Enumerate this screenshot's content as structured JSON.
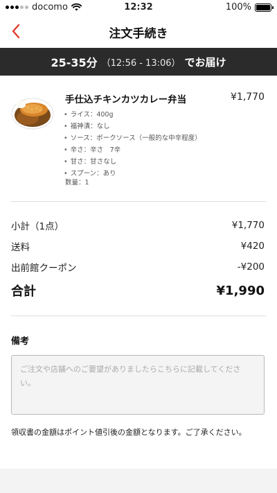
{
  "status_bar": {
    "carrier": "docomo",
    "time": "12:32",
    "battery": "100%"
  },
  "nav": {
    "title": "注文手続き",
    "back_icon": "chevron-left-icon",
    "accent": "#e23b2e"
  },
  "delivery": {
    "range": "25-35分",
    "window": "（12:56 - 13:06）",
    "suffix": "でお届け"
  },
  "item": {
    "name": "手仕込チキンカツカレー弁当",
    "price": "¥1,770",
    "options": [
      "ライス：400g",
      "福神漬：なし",
      "ソース：ポークソース（一般的な中辛程度）",
      "辛さ：辛さ　7辛",
      "甘さ：甘さなし",
      "スプーン：あり"
    ],
    "quantity": "数量：1"
  },
  "summary": {
    "subtotal_label": "小計（1点）",
    "subtotal_value": "¥1,770",
    "shipping_label": "送料",
    "shipping_value": "¥420",
    "coupon_label": "出前館クーポン",
    "coupon_value": "-¥200",
    "total_label": "合計",
    "total_value": "¥1,990"
  },
  "remarks": {
    "title": "備考",
    "placeholder": "ご注文や店舗へのご要望がありましたらこちらに記載してください。"
  },
  "note": "領収書の金額はポイント値引後の金額となります。ご了承ください。"
}
